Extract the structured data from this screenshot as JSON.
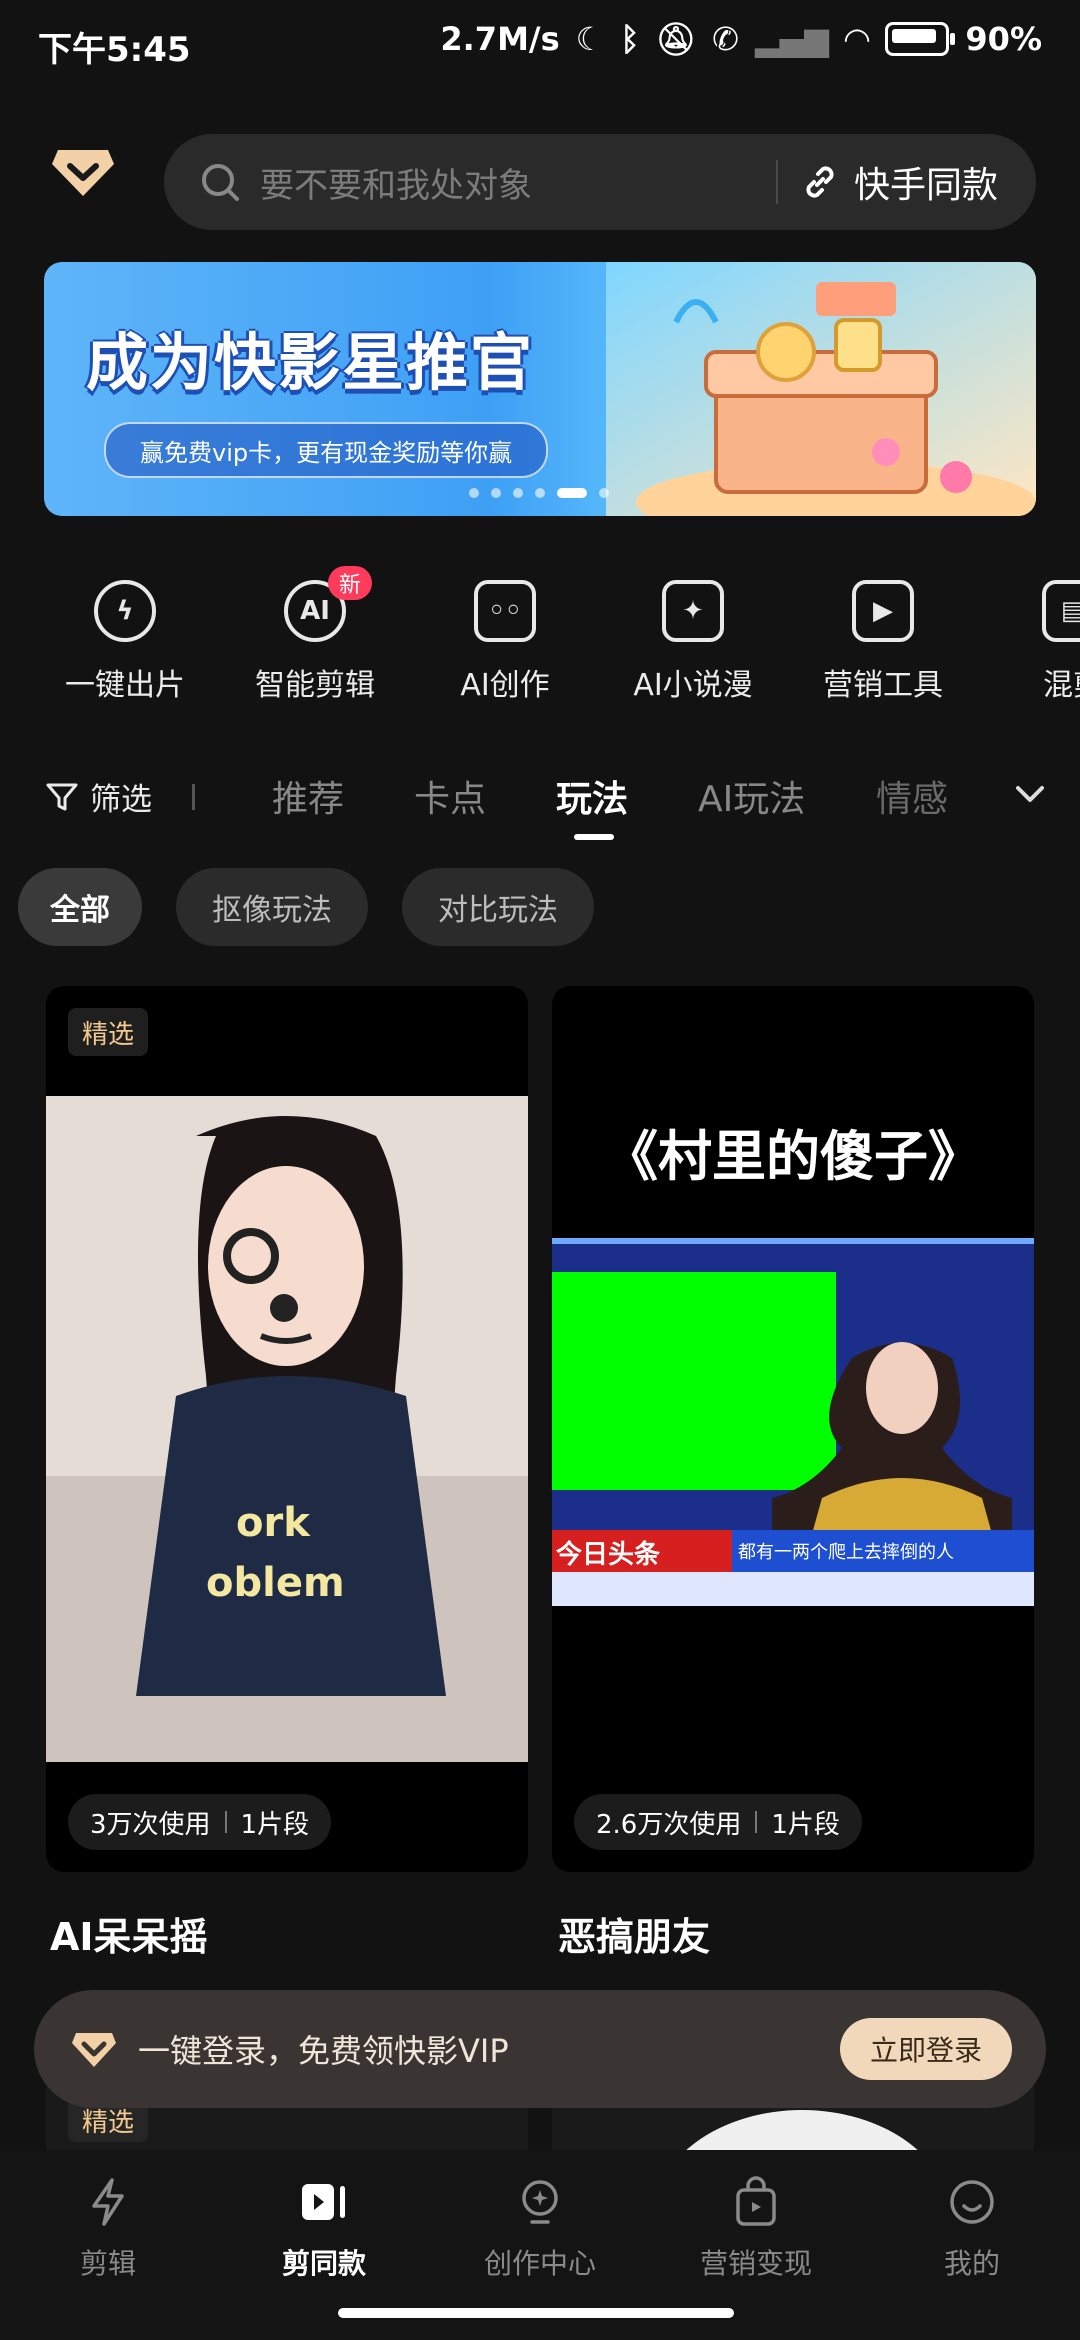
{
  "status_bar": {
    "time": "下午5:45",
    "net_speed": "2.7M/s",
    "battery": "90%"
  },
  "search": {
    "placeholder": "要不要和我处对象",
    "same_label": "快手同款"
  },
  "banner": {
    "title": "成为快影星推官",
    "subtitle": "赢免费vip卡，更有现金奖励等你赢",
    "dots": 6,
    "active_dot": 4
  },
  "tools": [
    {
      "label": "一键出片",
      "icon": "lightning-icon"
    },
    {
      "label": "智能剪辑",
      "icon": "ai-icon",
      "badge": "新"
    },
    {
      "label": "AI创作",
      "icon": "robot-icon"
    },
    {
      "label": "AI小说漫",
      "icon": "book-icon"
    },
    {
      "label": "营销工具",
      "icon": "play-sparkle-icon"
    },
    {
      "label": "混剪",
      "icon": "clapper-icon"
    }
  ],
  "ai_glyph": "AI",
  "filter_label": "筛选",
  "tabs": [
    "推荐",
    "卡点",
    "玩法",
    "AI玩法",
    "情感"
  ],
  "active_tab": "玩法",
  "chips": [
    "全部",
    "抠像玩法",
    "对比玩法"
  ],
  "cards": [
    {
      "tag": "精选",
      "uses": "3万次使用",
      "segments": "1片段",
      "title": "AI呆呆摇"
    },
    {
      "tag": "",
      "overlay_title": "《村里的傻子》",
      "news_ticker": "今日头条",
      "news_caption": "都有一两个爬上去摔倒的人",
      "uses": "2.6万次使用",
      "segments": "1片段",
      "title": "恶搞朋友"
    }
  ],
  "card2_tag": "精选",
  "toast": {
    "message": "一键登录，免费领快影VIP",
    "button": "立即登录"
  },
  "nav": [
    {
      "label": "剪辑",
      "icon": "lightning-icon"
    },
    {
      "label": "剪同款",
      "icon": "play-card-icon",
      "active": true
    },
    {
      "label": "创作中心",
      "icon": "bulb-icon"
    },
    {
      "label": "营销变现",
      "icon": "bag-icon"
    },
    {
      "label": "我的",
      "icon": "smile-icon"
    }
  ],
  "colors": {
    "background": "#121212",
    "accent_gold": "#f1d8bb",
    "badge_red": "#ff3b5c",
    "chroma_green": "#00ff00"
  }
}
